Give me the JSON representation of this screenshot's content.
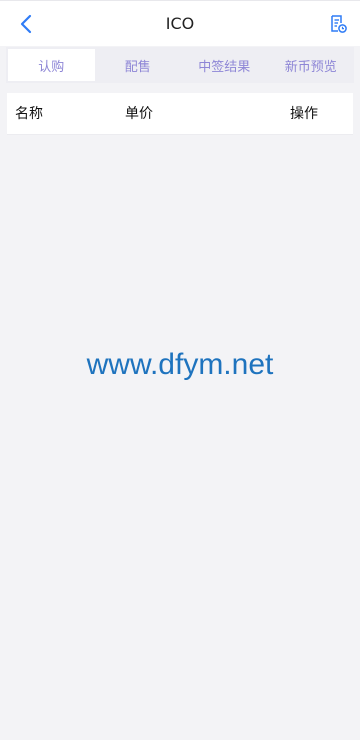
{
  "header": {
    "title": "ICO",
    "back_icon": "chevron-left-icon",
    "doc_icon": "document-clock-icon",
    "accent_color": "#2f7cf6"
  },
  "tabs": [
    {
      "label": "认购",
      "active": true
    },
    {
      "label": "配售",
      "active": false
    },
    {
      "label": "中签结果",
      "active": false
    },
    {
      "label": "新币预览",
      "active": false
    }
  ],
  "table": {
    "columns": [
      "名称",
      "单价",
      "操作"
    ]
  },
  "watermark": "www.dfym.net"
}
